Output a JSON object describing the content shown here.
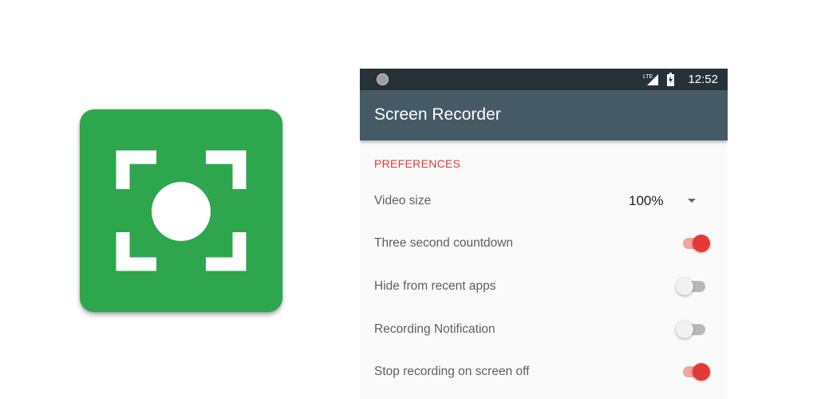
{
  "app_icon": {
    "name": "screen-record-icon",
    "color": "#2ea64d"
  },
  "status_bar": {
    "time": "12:52",
    "network": "LTE",
    "icons": [
      "notification-dot-icon",
      "lte-signal-icon",
      "battery-charging-icon"
    ]
  },
  "toolbar": {
    "title": "Screen Recorder",
    "color": "#455a64"
  },
  "preferences": {
    "header": "PREFERENCES",
    "accent": "#e53935",
    "video_size": {
      "label": "Video size",
      "value": "100%"
    },
    "items": [
      {
        "label": "Three second countdown",
        "checked": true
      },
      {
        "label": "Hide from recent apps",
        "checked": false
      },
      {
        "label": "Recording Notification",
        "checked": false
      },
      {
        "label": "Stop recording on screen off",
        "checked": true
      }
    ]
  }
}
